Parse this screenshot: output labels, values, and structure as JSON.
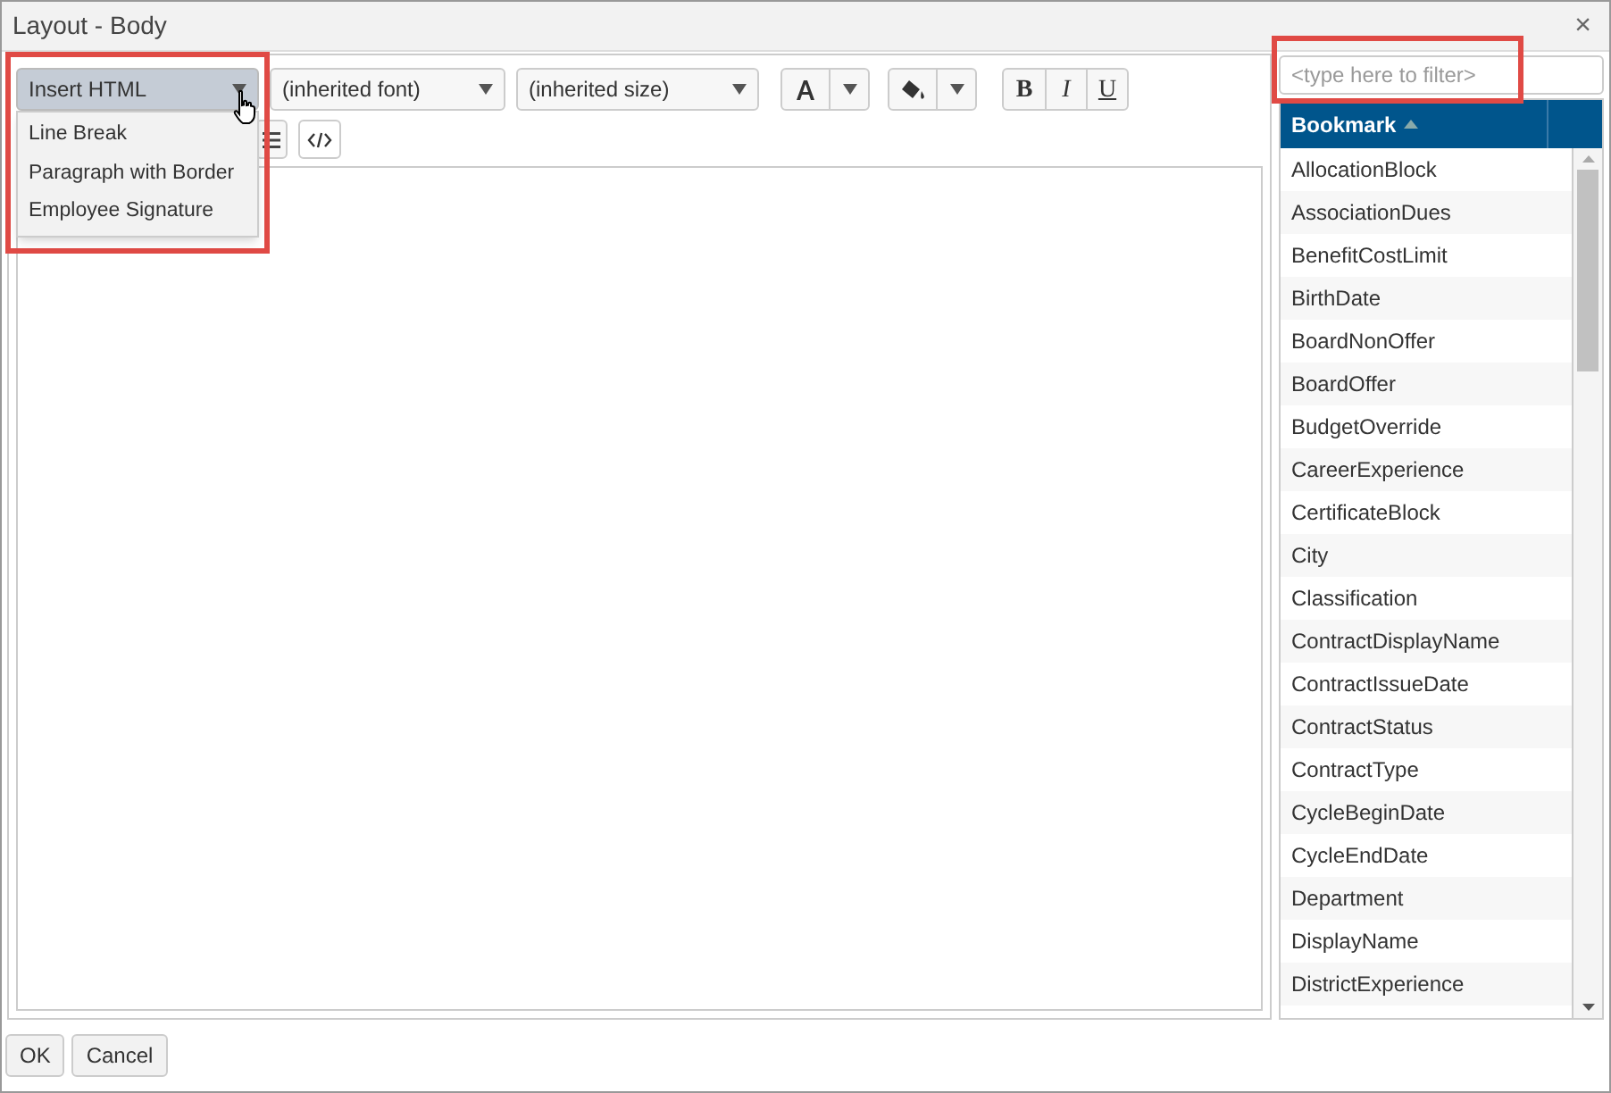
{
  "window": {
    "title": "Layout - Body",
    "close": "×"
  },
  "insert_html": {
    "label": "Insert HTML",
    "expanded": true,
    "items": [
      {
        "label": "Line Break"
      },
      {
        "label": "Paragraph with Border"
      },
      {
        "label": "Employee Signature"
      }
    ]
  },
  "font_select": {
    "value": "(inherited font)"
  },
  "size_select": {
    "value": "(inherited size)"
  },
  "format_buttons": [
    {
      "label": "B",
      "kind": "bold"
    },
    {
      "label": "I",
      "kind": "italic"
    },
    {
      "label": "U",
      "kind": "underline"
    }
  ],
  "filter": {
    "placeholder": "<type here to filter>"
  },
  "table": {
    "columns": [
      {
        "label": "Bookmark",
        "sorted_ascending": true
      }
    ],
    "rows": [
      "AllocationBlock",
      "AssociationDues",
      "BenefitCostLimit",
      "BirthDate",
      "BoardNonOffer",
      "BoardOffer",
      "BudgetOverride",
      "CareerExperience",
      "CertificateBlock",
      "City",
      "Classification",
      "ContractDisplayName",
      "ContractIssueDate",
      "ContractStatus",
      "ContractType",
      "CycleBeginDate",
      "CycleEndDate",
      "Department",
      "DisplayName",
      "DistrictExperience"
    ]
  },
  "buttons": [
    {
      "label": "OK"
    },
    {
      "label": "Cancel"
    }
  ]
}
